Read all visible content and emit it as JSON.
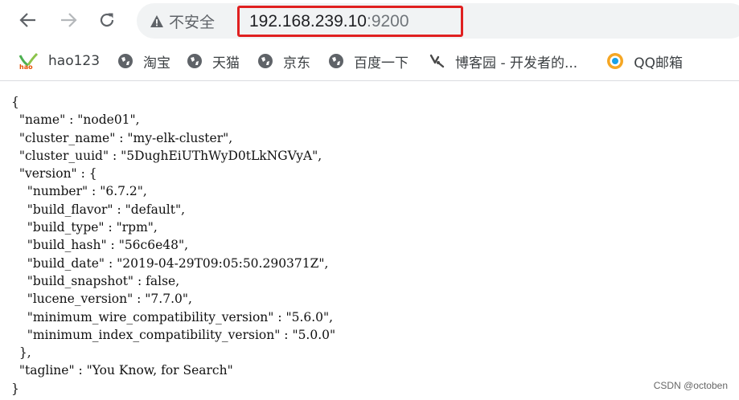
{
  "toolbar": {
    "security_label": "不安全",
    "url_host": "192.168.239.10",
    "url_port": ":9200"
  },
  "bookmarks": [
    {
      "label": "hao123",
      "icon": "hao123-icon"
    },
    {
      "label": "淘宝",
      "icon": "globe-icon"
    },
    {
      "label": "天猫",
      "icon": "globe-icon"
    },
    {
      "label": "京东",
      "icon": "globe-icon"
    },
    {
      "label": "百度一下",
      "icon": "globe-icon"
    },
    {
      "label": "博客园 - 开发者的...",
      "icon": "cnblogs-icon"
    },
    {
      "label": "QQ邮箱",
      "icon": "qq-mail-icon"
    }
  ],
  "json_lines": [
    "{",
    "  \"name\" : \"node01\",",
    "  \"cluster_name\" : \"my-elk-cluster\",",
    "  \"cluster_uuid\" : \"5DughEiUThWyD0tLkNGVyA\",",
    "  \"version\" : {",
    "    \"number\" : \"6.7.2\",",
    "    \"build_flavor\" : \"default\",",
    "    \"build_type\" : \"rpm\",",
    "    \"build_hash\" : \"56c6e48\",",
    "    \"build_date\" : \"2019-04-29T09:05:50.290371Z\",",
    "    \"build_snapshot\" : false,",
    "    \"lucene_version\" : \"7.7.0\",",
    "    \"minimum_wire_compatibility_version\" : \"5.6.0\",",
    "    \"minimum_index_compatibility_version\" : \"5.0.0\"",
    "  },",
    "  \"tagline\" : \"You Know, for Search\"",
    "}"
  ],
  "watermark": "CSDN @octoben",
  "colors": {
    "url_highlight": "#e02020",
    "omnibox_bg": "#f1f3f4"
  }
}
